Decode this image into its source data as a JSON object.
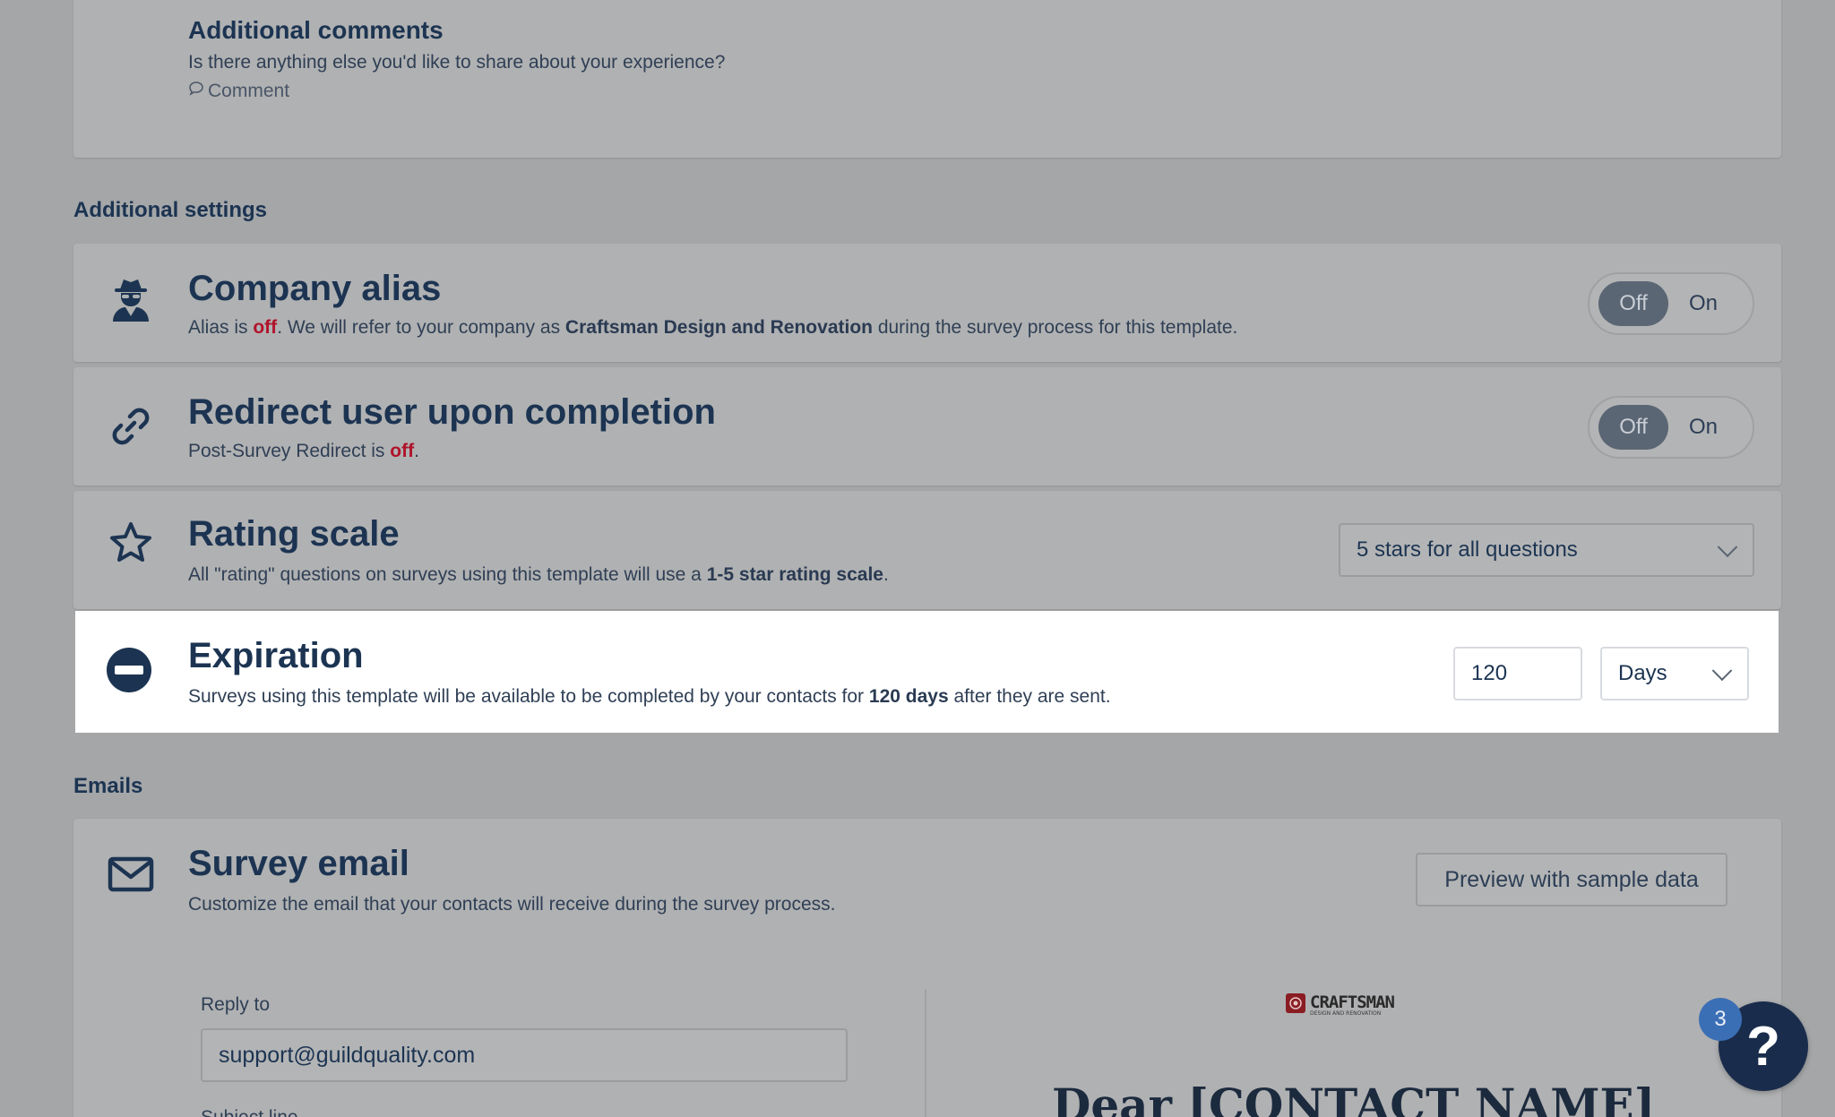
{
  "comments_card": {
    "title": "Additional comments",
    "question": "Is there anything else you'd like to share about your experience?",
    "type_label": "Comment"
  },
  "additional_settings": {
    "heading": "Additional settings",
    "company_alias": {
      "title": "Company alias",
      "desc_prefix": "Alias is ",
      "desc_state": "off",
      "desc_mid": ". We will refer to your company as ",
      "company_name": "Craftsman Design and Renovation",
      "desc_suffix": " during the survey process for this template.",
      "toggle_off": "Off",
      "toggle_on": "On"
    },
    "redirect": {
      "title": "Redirect user upon completion",
      "desc_prefix": "Post-Survey Redirect is ",
      "desc_state": "off",
      "desc_suffix": ".",
      "toggle_off": "Off",
      "toggle_on": "On"
    },
    "rating_scale": {
      "title": "Rating scale",
      "desc_prefix": "All \"rating\" questions on surveys using this template will use a ",
      "desc_bold": "1-5 star rating scale",
      "desc_suffix": ".",
      "selected": "5 stars for all questions"
    },
    "expiration": {
      "title": "Expiration",
      "desc_prefix": "Surveys using this template will be available to be completed by your contacts for ",
      "desc_bold": "120 days",
      "desc_suffix": " after they are sent.",
      "value": "120",
      "unit": "Days"
    }
  },
  "emails": {
    "heading": "Emails",
    "survey_email": {
      "title": "Survey email",
      "desc": "Customize the email that your contacts will receive during the survey process.",
      "preview_button": "Preview with sample data",
      "reply_to_label": "Reply to",
      "reply_to_value": "support@guildquality.com",
      "next_label_partial": "Subject line",
      "preview_logo_text": "CRAFTSMAN",
      "preview_logo_sub": "DESIGN AND RENOVATION",
      "preview_greeting": "Dear [CONTACT NAME]"
    }
  },
  "help": {
    "badge_count": "3",
    "glyph": "?"
  },
  "colors": {
    "brand_navy": "#1c3452",
    "off_red": "#b0122a",
    "badge_blue": "#3b6fb5"
  }
}
